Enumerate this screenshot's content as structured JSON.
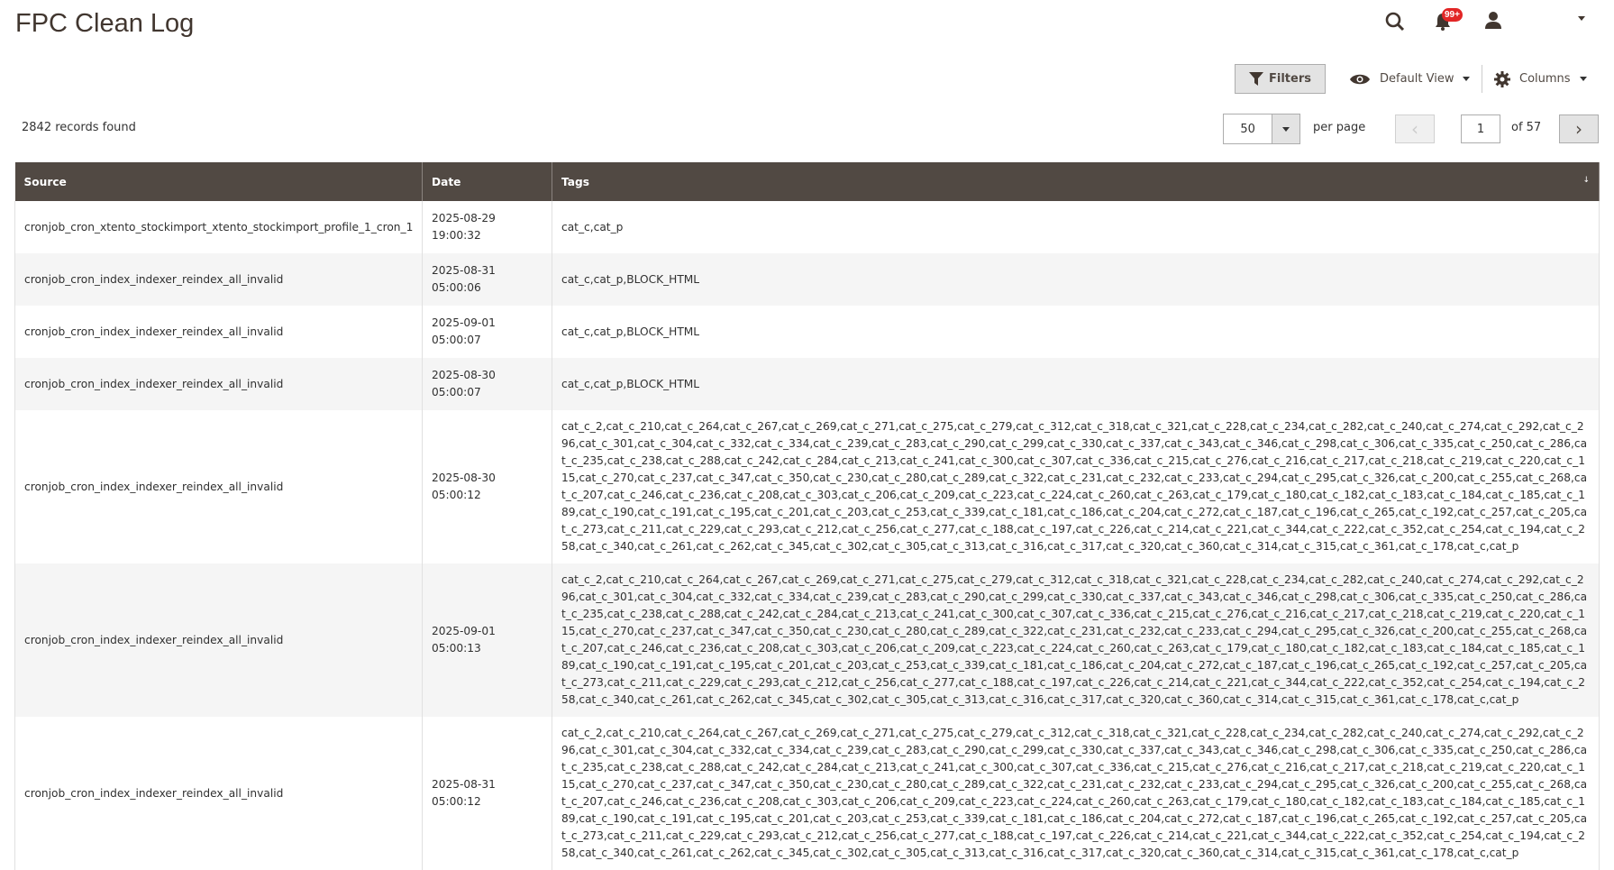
{
  "page": {
    "title": "FPC Clean Log"
  },
  "header": {
    "notification_count": "99+"
  },
  "toolbar": {
    "filters_label": "Filters",
    "view_label": "Default View",
    "columns_label": "Columns"
  },
  "grid": {
    "records_found": "2842 records found",
    "per_page_value": "50",
    "per_page_label": "per page",
    "current_page": "1",
    "total_pages_label": "of 57",
    "columns": [
      "Source",
      "Date",
      "Tags"
    ],
    "rows": [
      {
        "source": "cronjob_cron_xtento_stockimport_xtento_stockimport_profile_1_cron_1",
        "date": "2025-08-29 19:00:32",
        "tags": "cat_c,cat_p"
      },
      {
        "source": "cronjob_cron_index_indexer_reindex_all_invalid",
        "date": "2025-08-31 05:00:06",
        "tags": "cat_c,cat_p,BLOCK_HTML"
      },
      {
        "source": "cronjob_cron_index_indexer_reindex_all_invalid",
        "date": "2025-09-01 05:00:07",
        "tags": "cat_c,cat_p,BLOCK_HTML"
      },
      {
        "source": "cronjob_cron_index_indexer_reindex_all_invalid",
        "date": "2025-08-30 05:00:07",
        "tags": "cat_c,cat_p,BLOCK_HTML"
      },
      {
        "source": "cronjob_cron_index_indexer_reindex_all_invalid",
        "date": "2025-08-30 05:00:12",
        "tags": "cat_c_2,cat_c_210,cat_c_264,cat_c_267,cat_c_269,cat_c_271,cat_c_275,cat_c_279,cat_c_312,cat_c_318,cat_c_321,cat_c_228,cat_c_234,cat_c_282,cat_c_240,cat_c_274,cat_c_292,cat_c_296,cat_c_301,cat_c_304,cat_c_332,cat_c_334,cat_c_239,cat_c_283,cat_c_290,cat_c_299,cat_c_330,cat_c_337,cat_c_343,cat_c_346,cat_c_298,cat_c_306,cat_c_335,cat_c_250,cat_c_286,cat_c_235,cat_c_238,cat_c_288,cat_c_242,cat_c_284,cat_c_213,cat_c_241,cat_c_300,cat_c_307,cat_c_336,cat_c_215,cat_c_276,cat_c_216,cat_c_217,cat_c_218,cat_c_219,cat_c_220,cat_c_115,cat_c_270,cat_c_237,cat_c_347,cat_c_350,cat_c_230,cat_c_280,cat_c_289,cat_c_322,cat_c_231,cat_c_232,cat_c_233,cat_c_294,cat_c_295,cat_c_326,cat_c_200,cat_c_255,cat_c_268,cat_c_207,cat_c_246,cat_c_236,cat_c_208,cat_c_303,cat_c_206,cat_c_209,cat_c_223,cat_c_224,cat_c_260,cat_c_263,cat_c_179,cat_c_180,cat_c_182,cat_c_183,cat_c_184,cat_c_185,cat_c_189,cat_c_190,cat_c_191,cat_c_195,cat_c_201,cat_c_203,cat_c_253,cat_c_339,cat_c_181,cat_c_186,cat_c_204,cat_c_272,cat_c_187,cat_c_196,cat_c_265,cat_c_192,cat_c_257,cat_c_205,cat_c_273,cat_c_211,cat_c_229,cat_c_293,cat_c_212,cat_c_256,cat_c_277,cat_c_188,cat_c_197,cat_c_226,cat_c_214,cat_c_221,cat_c_344,cat_c_222,cat_c_352,cat_c_254,cat_c_194,cat_c_258,cat_c_340,cat_c_261,cat_c_262,cat_c_345,cat_c_302,cat_c_305,cat_c_313,cat_c_316,cat_c_317,cat_c_320,cat_c_360,cat_c_314,cat_c_315,cat_c_361,cat_c_178,cat_c,cat_p"
      },
      {
        "source": "cronjob_cron_index_indexer_reindex_all_invalid",
        "date": "2025-09-01 05:00:13",
        "tags": "cat_c_2,cat_c_210,cat_c_264,cat_c_267,cat_c_269,cat_c_271,cat_c_275,cat_c_279,cat_c_312,cat_c_318,cat_c_321,cat_c_228,cat_c_234,cat_c_282,cat_c_240,cat_c_274,cat_c_292,cat_c_296,cat_c_301,cat_c_304,cat_c_332,cat_c_334,cat_c_239,cat_c_283,cat_c_290,cat_c_299,cat_c_330,cat_c_337,cat_c_343,cat_c_346,cat_c_298,cat_c_306,cat_c_335,cat_c_250,cat_c_286,cat_c_235,cat_c_238,cat_c_288,cat_c_242,cat_c_284,cat_c_213,cat_c_241,cat_c_300,cat_c_307,cat_c_336,cat_c_215,cat_c_276,cat_c_216,cat_c_217,cat_c_218,cat_c_219,cat_c_220,cat_c_115,cat_c_270,cat_c_237,cat_c_347,cat_c_350,cat_c_230,cat_c_280,cat_c_289,cat_c_322,cat_c_231,cat_c_232,cat_c_233,cat_c_294,cat_c_295,cat_c_326,cat_c_200,cat_c_255,cat_c_268,cat_c_207,cat_c_246,cat_c_236,cat_c_208,cat_c_303,cat_c_206,cat_c_209,cat_c_223,cat_c_224,cat_c_260,cat_c_263,cat_c_179,cat_c_180,cat_c_182,cat_c_183,cat_c_184,cat_c_185,cat_c_189,cat_c_190,cat_c_191,cat_c_195,cat_c_201,cat_c_203,cat_c_253,cat_c_339,cat_c_181,cat_c_186,cat_c_204,cat_c_272,cat_c_187,cat_c_196,cat_c_265,cat_c_192,cat_c_257,cat_c_205,cat_c_273,cat_c_211,cat_c_229,cat_c_293,cat_c_212,cat_c_256,cat_c_277,cat_c_188,cat_c_197,cat_c_226,cat_c_214,cat_c_221,cat_c_344,cat_c_222,cat_c_352,cat_c_254,cat_c_194,cat_c_258,cat_c_340,cat_c_261,cat_c_262,cat_c_345,cat_c_302,cat_c_305,cat_c_313,cat_c_316,cat_c_317,cat_c_320,cat_c_360,cat_c_314,cat_c_315,cat_c_361,cat_c_178,cat_c,cat_p"
      },
      {
        "source": "cronjob_cron_index_indexer_reindex_all_invalid",
        "date": "2025-08-31 05:00:12",
        "tags": "cat_c_2,cat_c_210,cat_c_264,cat_c_267,cat_c_269,cat_c_271,cat_c_275,cat_c_279,cat_c_312,cat_c_318,cat_c_321,cat_c_228,cat_c_234,cat_c_282,cat_c_240,cat_c_274,cat_c_292,cat_c_296,cat_c_301,cat_c_304,cat_c_332,cat_c_334,cat_c_239,cat_c_283,cat_c_290,cat_c_299,cat_c_330,cat_c_337,cat_c_343,cat_c_346,cat_c_298,cat_c_306,cat_c_335,cat_c_250,cat_c_286,cat_c_235,cat_c_238,cat_c_288,cat_c_242,cat_c_284,cat_c_213,cat_c_241,cat_c_300,cat_c_307,cat_c_336,cat_c_215,cat_c_276,cat_c_216,cat_c_217,cat_c_218,cat_c_219,cat_c_220,cat_c_115,cat_c_270,cat_c_237,cat_c_347,cat_c_350,cat_c_230,cat_c_280,cat_c_289,cat_c_322,cat_c_231,cat_c_232,cat_c_233,cat_c_294,cat_c_295,cat_c_326,cat_c_200,cat_c_255,cat_c_268,cat_c_207,cat_c_246,cat_c_236,cat_c_208,cat_c_303,cat_c_206,cat_c_209,cat_c_223,cat_c_224,cat_c_260,cat_c_263,cat_c_179,cat_c_180,cat_c_182,cat_c_183,cat_c_184,cat_c_185,cat_c_189,cat_c_190,cat_c_191,cat_c_195,cat_c_201,cat_c_203,cat_c_253,cat_c_339,cat_c_181,cat_c_186,cat_c_204,cat_c_272,cat_c_187,cat_c_196,cat_c_265,cat_c_192,cat_c_257,cat_c_205,cat_c_273,cat_c_211,cat_c_229,cat_c_293,cat_c_212,cat_c_256,cat_c_277,cat_c_188,cat_c_197,cat_c_226,cat_c_214,cat_c_221,cat_c_344,cat_c_222,cat_c_352,cat_c_254,cat_c_194,cat_c_258,cat_c_340,cat_c_261,cat_c_262,cat_c_345,cat_c_302,cat_c_305,cat_c_313,cat_c_316,cat_c_317,cat_c_320,cat_c_360,cat_c_314,cat_c_315,cat_c_361,cat_c_178,cat_c,cat_p"
      }
    ]
  },
  "colors": {
    "header_bg": "#514943",
    "badge": "#e22626",
    "alt_row": "#f5f5f5"
  },
  "icons": [
    "search-icon",
    "bell-icon",
    "user-icon",
    "filter-icon",
    "eye-icon",
    "gear-icon"
  ]
}
